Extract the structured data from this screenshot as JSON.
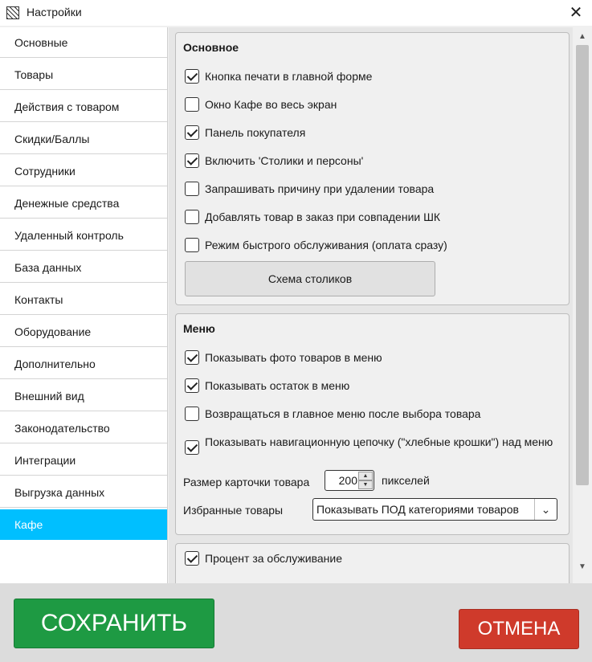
{
  "window": {
    "title": "Настройки",
    "close_glyph": "✕"
  },
  "sidebar": {
    "items": [
      {
        "label": "Основные"
      },
      {
        "label": "Товары"
      },
      {
        "label": "Действия с товаром"
      },
      {
        "label": "Скидки/Баллы"
      },
      {
        "label": "Сотрудники"
      },
      {
        "label": "Денежные средства"
      },
      {
        "label": "Удаленный контроль"
      },
      {
        "label": "База данных"
      },
      {
        "label": "Контакты"
      },
      {
        "label": "Оборудование"
      },
      {
        "label": "Дополнительно"
      },
      {
        "label": "Внешний вид"
      },
      {
        "label": "Законодательство"
      },
      {
        "label": "Интеграции"
      },
      {
        "label": "Выгрузка данных"
      },
      {
        "label": "Кафе",
        "active": true
      }
    ],
    "active_color": "#00bfff"
  },
  "basic": {
    "title": "Основное",
    "options": [
      {
        "label": "Кнопка печати в главной форме",
        "checked": true
      },
      {
        "label": "Окно Кафе во весь экран",
        "checked": false
      },
      {
        "label": "Панель покупателя",
        "checked": true
      },
      {
        "label": "Включить 'Столики и персоны'",
        "checked": true
      },
      {
        "label": "Запрашивать причину при удалении товара",
        "checked": false
      },
      {
        "label": "Добавлять товар в заказ при совпадении ШК",
        "checked": false
      },
      {
        "label": "Режим быстрого обслуживания (оплата сразу)",
        "checked": false
      }
    ],
    "scheme_button": "Схема столиков"
  },
  "menu": {
    "title": "Меню",
    "options": [
      {
        "label": "Показывать фото товаров в меню",
        "checked": true
      },
      {
        "label": "Показывать остаток в меню",
        "checked": true
      },
      {
        "label": "Возвращаться в главное меню после выбора товара",
        "checked": false
      },
      {
        "label": "Показывать навигационную цепочку (\"хлебные крошки\") над меню",
        "checked": true
      }
    ],
    "card_size_label": "Размер карточки товара",
    "card_size_value": "200",
    "card_size_unit": "пикселей",
    "favorites_label": "Избранные товары",
    "favorites_value": "Показывать ПОД категориями товаров"
  },
  "service": {
    "options": [
      {
        "label": "Процент за обслуживание",
        "checked": true
      }
    ]
  },
  "icons": {
    "app": "app-icon",
    "close": "close-icon",
    "check": "checkmark-icon",
    "arrow": "chevron-down-icon"
  },
  "footer": {
    "save_label": "СОХРАНИТЬ",
    "cancel_label": "ОТМЕНА",
    "save_color": "#1e9a43",
    "cancel_color": "#cf3a2b"
  }
}
